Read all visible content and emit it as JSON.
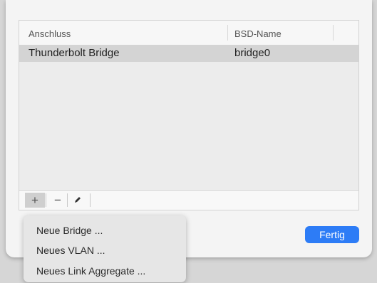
{
  "table": {
    "headers": [
      "Anschluss",
      "BSD-Name"
    ],
    "rows": [
      {
        "name": "Thunderbolt Bridge",
        "bsd": "bridge0",
        "selected": true
      }
    ]
  },
  "toolbar": {
    "add_label": "+",
    "remove_label": "−",
    "edit_icon": "pencil-icon"
  },
  "buttons": {
    "done_label": "Fertig",
    "accent_color": "#2d7cf6"
  },
  "menu": {
    "items": [
      "Neue Bridge ...",
      "Neues VLAN ...",
      "Neues Link Aggregate ..."
    ]
  }
}
